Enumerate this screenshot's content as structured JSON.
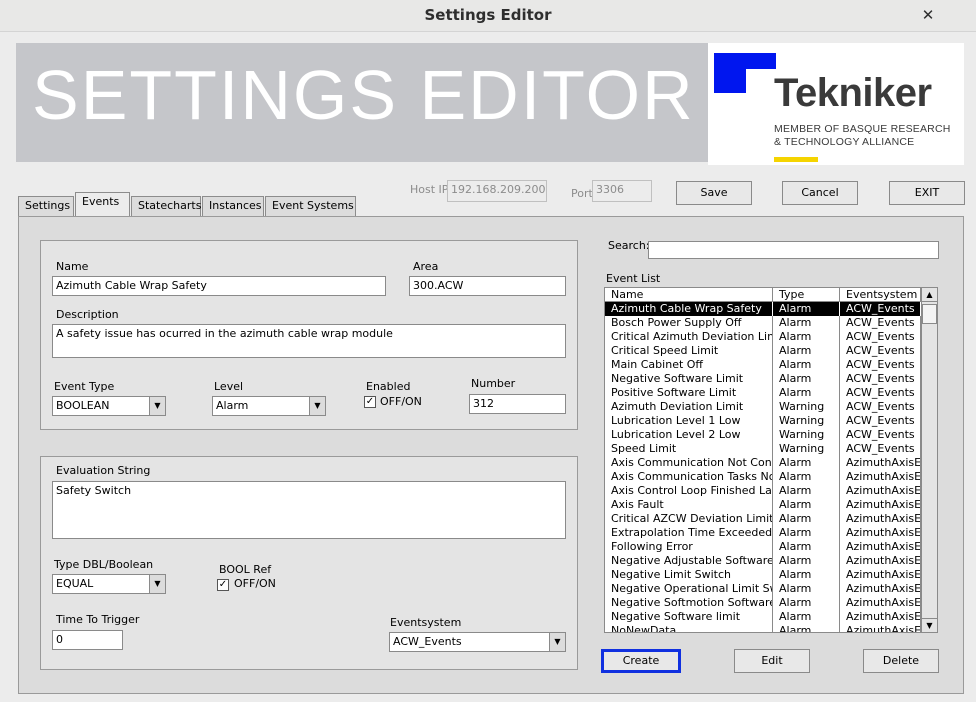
{
  "window": {
    "title": "Settings Editor",
    "close_glyph": "✕"
  },
  "banner": {
    "title": "SETTINGS EDITOR",
    "logo_name": "Tekniker",
    "logo_sub_1": "MEMBER OF BASQUE RESEARCH",
    "logo_sub_2": "& TECHNOLOGY ALLIANCE",
    "brand_blue": "#0016ef",
    "brand_yellow": "#f5d400"
  },
  "tabs": [
    "Settings",
    "Events",
    "Statecharts",
    "Instances",
    "Event Systems"
  ],
  "connection": {
    "host_label": "Host IP",
    "host_value": "192.168.209.200",
    "port_label": "Port",
    "port_value": "3306"
  },
  "top_buttons": {
    "save": "Save",
    "cancel": "Cancel",
    "exit": "EXIT"
  },
  "event_form": {
    "name_label": "Name",
    "name_value": "Azimuth Cable Wrap Safety",
    "area_label": "Area",
    "area_value": "300.ACW",
    "description_label": "Description",
    "description_value": "A safety issue has ocurred in the azimuth cable wrap module",
    "event_type_label": "Event Type",
    "event_type_value": "BOOLEAN",
    "level_label": "Level",
    "level_value": "Alarm",
    "enabled_label": "Enabled",
    "enabled_check": "OFF/ON",
    "number_label": "Number",
    "number_value": "312"
  },
  "eval_form": {
    "eval_label": "Evaluation String",
    "eval_value": "Safety Switch",
    "type_label": "Type DBL/Boolean",
    "type_value": "EQUAL",
    "boolref_label": "BOOL Ref",
    "boolref_check": "OFF/ON",
    "time_label": "Time To Trigger",
    "time_value": "0",
    "eventsystem_label": "Eventsystem",
    "eventsystem_value": "ACW_Events"
  },
  "search": {
    "label": "Search:",
    "value": ""
  },
  "event_list": {
    "label": "Event List",
    "columns": [
      "Name",
      "Type",
      "Eventsystem"
    ],
    "rows": [
      [
        "Azimuth Cable Wrap Safety",
        "Alarm",
        "ACW_Events"
      ],
      [
        "Bosch Power Supply Off",
        "Alarm",
        "ACW_Events"
      ],
      [
        "Critical Azimuth Deviation Limit",
        "Alarm",
        "ACW_Events"
      ],
      [
        "Critical Speed Limit",
        "Alarm",
        "ACW_Events"
      ],
      [
        "Main Cabinet Off",
        "Alarm",
        "ACW_Events"
      ],
      [
        "Negative Software Limit",
        "Alarm",
        "ACW_Events"
      ],
      [
        "Positive Software Limit",
        "Alarm",
        "ACW_Events"
      ],
      [
        "Azimuth Deviation Limit",
        "Warning",
        "ACW_Events"
      ],
      [
        "Lubrication Level 1 Low",
        "Warning",
        "ACW_Events"
      ],
      [
        "Lubrication Level 2 Low",
        "Warning",
        "ACW_Events"
      ],
      [
        "Speed Limit",
        "Warning",
        "ACW_Events"
      ],
      [
        "Axis Communication Not Connected",
        "Alarm",
        "AzimuthAxisEvents"
      ],
      [
        "Axis Communication Tasks Not Running",
        "Alarm",
        "AzimuthAxisEvents"
      ],
      [
        "Axis Control Loop Finished Late",
        "Alarm",
        "AzimuthAxisEvents"
      ],
      [
        "Axis Fault",
        "Alarm",
        "AzimuthAxisEvents"
      ],
      [
        "Critical AZCW Deviation Limit",
        "Alarm",
        "AzimuthAxisEvents"
      ],
      [
        "Extrapolation Time Exceeded",
        "Alarm",
        "AzimuthAxisEvents"
      ],
      [
        "Following Error",
        "Alarm",
        "AzimuthAxisEvents"
      ],
      [
        "Negative Adjustable Software limit",
        "Alarm",
        "AzimuthAxisEvents"
      ],
      [
        "Negative Limit Switch",
        "Alarm",
        "AzimuthAxisEvents"
      ],
      [
        "Negative Operational Limit Switch",
        "Alarm",
        "AzimuthAxisEvents"
      ],
      [
        "Negative Softmotion Software limit",
        "Alarm",
        "AzimuthAxisEvents"
      ],
      [
        "Negative Software limit",
        "Alarm",
        "AzimuthAxisEvents"
      ],
      [
        "NoNewData",
        "Alarm",
        "AzimuthAxisEvents"
      ]
    ]
  },
  "bottom_buttons": {
    "create": "Create",
    "edit": "Edit",
    "delete": "Delete"
  }
}
